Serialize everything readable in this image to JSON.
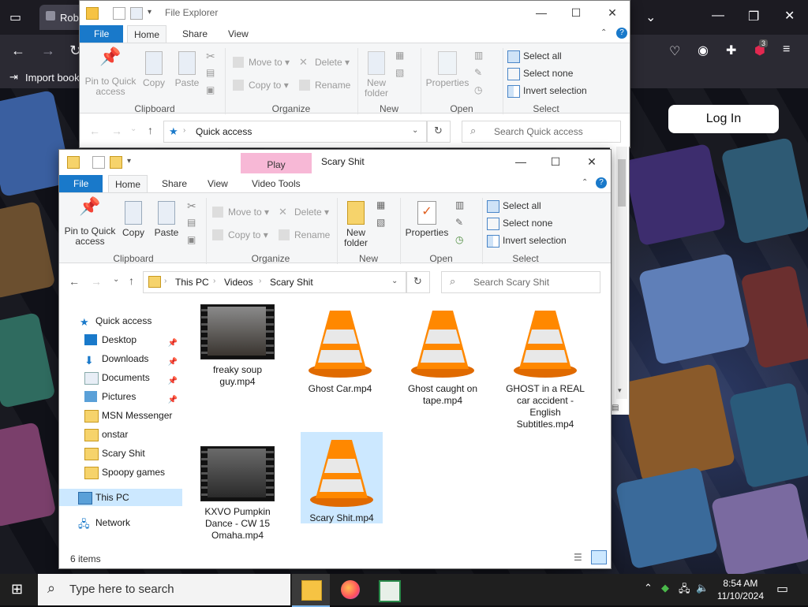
{
  "browser": {
    "tab_title": "Rob",
    "bookmark_label": "Import book",
    "extension_badge": "3"
  },
  "website": {
    "login_label": "Log In"
  },
  "explorer_back": {
    "title": "File Explorer",
    "tabs": [
      "File",
      "Home",
      "Share",
      "View"
    ],
    "ribbon": {
      "pin_label": "Pin to Quick access",
      "copy_label": "Copy",
      "paste_label": "Paste",
      "move_to": "Move to",
      "copy_to": "Copy to",
      "delete": "Delete",
      "rename": "Rename",
      "new_folder": "New folder",
      "properties": "Properties",
      "select_all": "Select all",
      "select_none": "Select none",
      "invert_selection": "Invert selection",
      "groups": [
        "Clipboard",
        "Organize",
        "New",
        "Open",
        "Select"
      ]
    },
    "address": "Quick access",
    "search_placeholder": "Search Quick access"
  },
  "explorer_front": {
    "title": "Scary Shit",
    "context_tab": "Play",
    "tabs": [
      "File",
      "Home",
      "Share",
      "View",
      "Video Tools"
    ],
    "ribbon": {
      "pin_label": "Pin to Quick access",
      "copy_label": "Copy",
      "paste_label": "Paste",
      "move_to": "Move to",
      "copy_to": "Copy to",
      "delete": "Delete",
      "rename": "Rename",
      "new_folder": "New folder",
      "properties": "Properties",
      "select_all": "Select all",
      "select_none": "Select none",
      "invert_selection": "Invert selection",
      "groups": [
        "Clipboard",
        "Organize",
        "New",
        "Open",
        "Select"
      ]
    },
    "breadcrumb": [
      "This PC",
      "Videos",
      "Scary Shit"
    ],
    "search_placeholder": "Search Scary Shit",
    "nav": {
      "quick_access": "Quick access",
      "items": [
        "Desktop",
        "Downloads",
        "Documents",
        "Pictures",
        "MSN Messenger",
        "onstar",
        "Scary Shit",
        "Spoopy games"
      ],
      "this_pc": "This PC",
      "network": "Network"
    },
    "files": [
      "freaky soup guy.mp4",
      "Ghost Car.mp4",
      "Ghost caught on tape.mp4",
      "GHOST in a REAL car accident - English Subtitles.mp4",
      "KXVO Pumpkin Dance - CW 15 Omaha.mp4",
      "Scary Shit.mp4"
    ],
    "status": "6 items"
  },
  "taskbar": {
    "search_placeholder": "Type here to search",
    "time": "8:54 AM",
    "date": "11/10/2024"
  },
  "colors": {
    "accent": "#1979ca",
    "play_tab": "#f7b8d6",
    "selection": "#cce8ff"
  }
}
